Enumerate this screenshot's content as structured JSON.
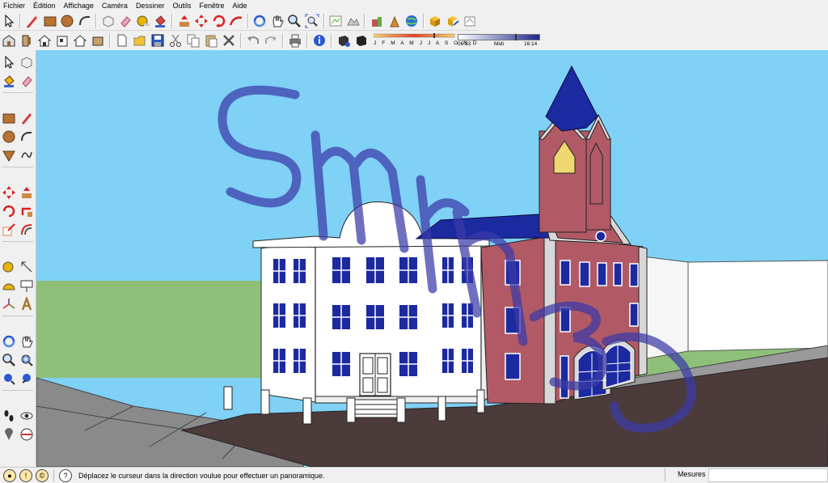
{
  "menu": [
    "Fichier",
    "Édition",
    "Affichage",
    "Caméra",
    "Dessiner",
    "Outils",
    "Fenêtre",
    "Aide"
  ],
  "shadow": {
    "months": "J F M A M J J A S O N D",
    "time_start": "06:53",
    "time_mid": "Midi",
    "time_end": "16:14"
  },
  "watermark": "Smrn 3D",
  "status": {
    "icon_info": "?",
    "message": "Déplacez le curseur dans la direction voulue pour effectuer un panoramique.",
    "measure_label": "Mesures"
  },
  "colors": {
    "sky": "#7fd1f6",
    "grass": "#8fc07a",
    "road": "#4b3b3b",
    "sidewalk": "#8a8a8a",
    "white_building": "#ffffff",
    "brick": "#b15a66",
    "roof": "#1c2aa0",
    "windows": "#1c2aa0",
    "watermark": "#3a3aa8"
  }
}
